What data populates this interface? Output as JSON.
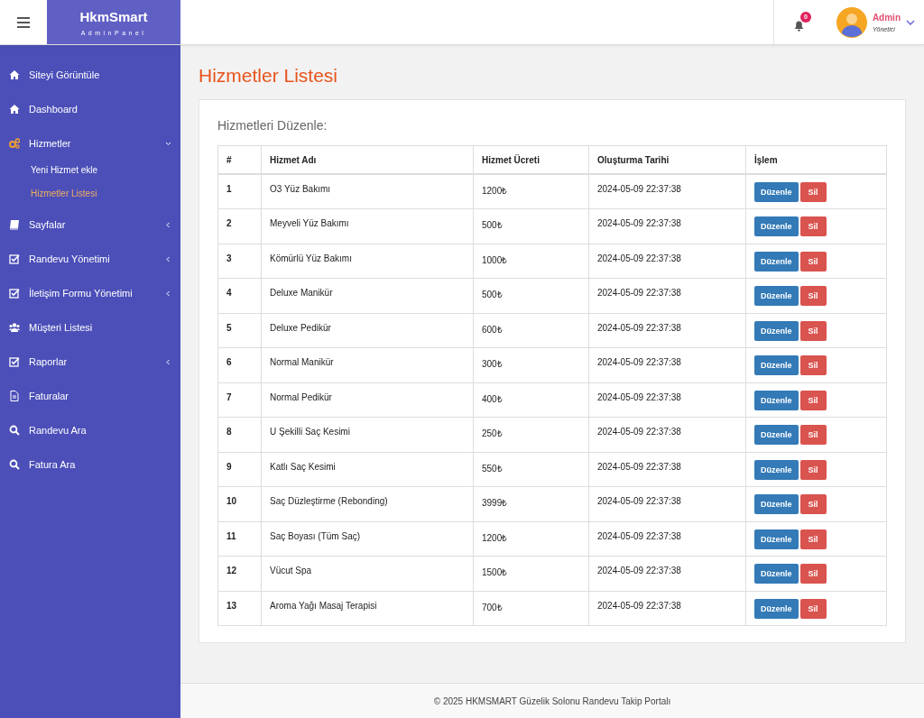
{
  "brand": {
    "name": "HkmSmart",
    "subtitle": "AdminPanel"
  },
  "header": {
    "notification_count": "0",
    "user_name": "Admin",
    "user_role": "Yönetici"
  },
  "sidebar": {
    "items": [
      {
        "label": "Siteyi Görüntüle",
        "kind": "home"
      },
      {
        "label": "Dashboard",
        "kind": "home"
      },
      {
        "label": "Hizmetler",
        "kind": "gears",
        "expanded": true,
        "children": [
          {
            "label": "Yeni Hizmet ekle",
            "selected": false
          },
          {
            "label": "Hizmetler Listesi",
            "selected": true
          }
        ]
      },
      {
        "label": "Sayfalar",
        "kind": "book",
        "expanded": false
      },
      {
        "label": "Randevu Yönetimi",
        "kind": "check",
        "expanded": false
      },
      {
        "label": "İletişim Formu Yönetimi",
        "kind": "check",
        "expanded": false
      },
      {
        "label": "Müşteri Listesi",
        "kind": "users"
      },
      {
        "label": "Raporlar",
        "kind": "check",
        "expanded": false
      },
      {
        "label": "Faturalar",
        "kind": "file"
      },
      {
        "label": "Randevu Ara",
        "kind": "search"
      },
      {
        "label": "Fatura Ara",
        "kind": "search"
      }
    ]
  },
  "page_title": "Hizmetler Listesi",
  "card_title": "Hizmetleri Düzenle:",
  "table": {
    "columns": [
      "#",
      "Hizmet Adı",
      "Hizmet Ücreti",
      "Oluşturma Tarihi",
      "İşlem"
    ],
    "rows": [
      {
        "cells": [
          "1",
          "O3 Yüz Bakımı",
          "1200₺",
          "2024-05-09 22:37:38"
        ],
        "edit": "Düzenle",
        "delete": "Sil"
      },
      {
        "cells": [
          "2",
          "Meyveli Yüz Bakımı",
          "500₺",
          "2024-05-09 22:37:38"
        ],
        "edit": "Düzenle",
        "delete": "Sil"
      },
      {
        "cells": [
          "3",
          "Kömürlü Yüz Bakımı",
          "1000₺",
          "2024-05-09 22:37:38"
        ],
        "edit": "Düzenle",
        "delete": "Sil"
      },
      {
        "cells": [
          "4",
          "Deluxe Manikür",
          "500₺",
          "2024-05-09 22:37:38"
        ],
        "edit": "Düzenle",
        "delete": "Sil"
      },
      {
        "cells": [
          "5",
          "Deluxe Pedikür",
          "600₺",
          "2024-05-09 22:37:38"
        ],
        "edit": "Düzenle",
        "delete": "Sil"
      },
      {
        "cells": [
          "6",
          "Normal Manikür",
          "300₺",
          "2024-05-09 22:37:38"
        ],
        "edit": "Düzenle",
        "delete": "Sil"
      },
      {
        "cells": [
          "7",
          "Normal Pedikür",
          "400₺",
          "2024-05-09 22:37:38"
        ],
        "edit": "Düzenle",
        "delete": "Sil"
      },
      {
        "cells": [
          "8",
          "U Şekilli Saç Kesimi",
          "250₺",
          "2024-05-09 22:37:38"
        ],
        "edit": "Düzenle",
        "delete": "Sil"
      },
      {
        "cells": [
          "9",
          "Katlı Saç Kesimi",
          "550₺",
          "2024-05-09 22:37:38"
        ],
        "edit": "Düzenle",
        "delete": "Sil"
      },
      {
        "cells": [
          "10",
          "Saç Düzleştirme (Rebonding)",
          "3999₺",
          "2024-05-09 22:37:38"
        ],
        "edit": "Düzenle",
        "delete": "Sil"
      },
      {
        "cells": [
          "11",
          "Saç Boyası (Tüm Saç)",
          "1200₺",
          "2024-05-09 22:37:38"
        ],
        "edit": "Düzenle",
        "delete": "Sil"
      },
      {
        "cells": [
          "12",
          "Vücut Spa",
          "1500₺",
          "2024-05-09 22:37:38"
        ],
        "edit": "Düzenle",
        "delete": "Sil"
      },
      {
        "cells": [
          "13",
          "Aroma Yağı Masaj Terapisi",
          "700₺",
          "2024-05-09 22:37:38"
        ],
        "edit": "Düzenle",
        "delete": "Sil"
      }
    ]
  },
  "footer": "© 2025 HKMSMART Güzelik Solonu Randevu Takip Portalı"
}
